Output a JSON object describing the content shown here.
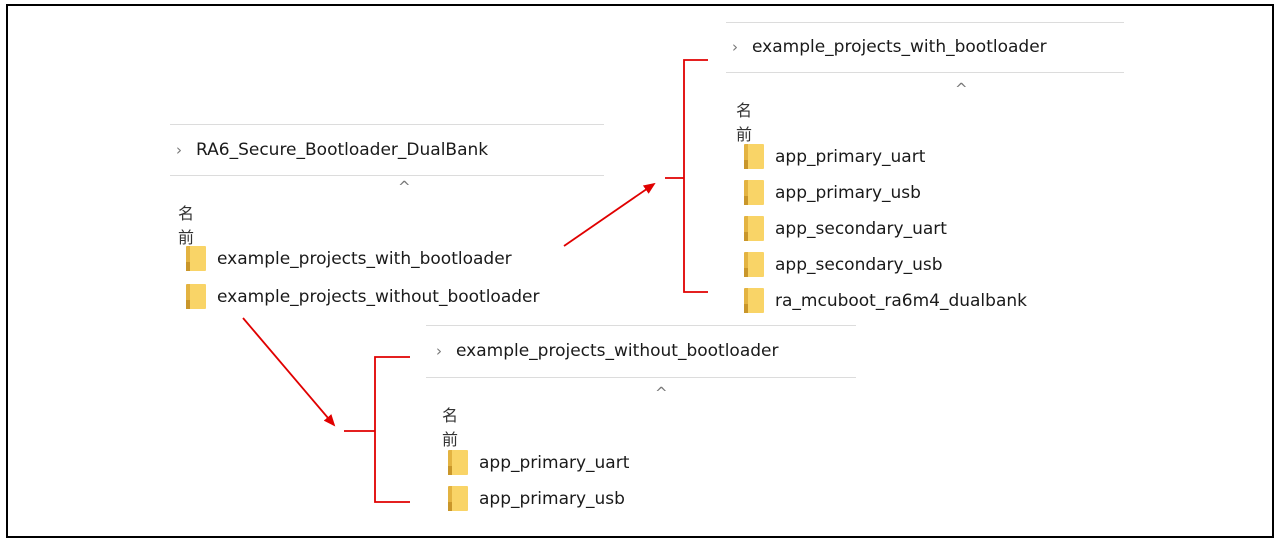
{
  "column_header": "名前",
  "sort_icon": "^",
  "root_panel": {
    "path": "RA6_Secure_Bootloader_DualBank",
    "items": [
      "example_projects_with_bootloader",
      "example_projects_without_bootloader"
    ]
  },
  "with_panel": {
    "path": "example_projects_with_bootloader",
    "items": [
      "app_primary_uart",
      "app_primary_usb",
      "app_secondary_uart",
      "app_secondary_usb",
      "ra_mcuboot_ra6m4_dualbank"
    ]
  },
  "without_panel": {
    "path": "example_projects_without_bootloader",
    "items": [
      "app_primary_uart",
      "app_primary_usb"
    ]
  },
  "colors": {
    "arrow": "#e00000",
    "folder": "#f9d467"
  }
}
